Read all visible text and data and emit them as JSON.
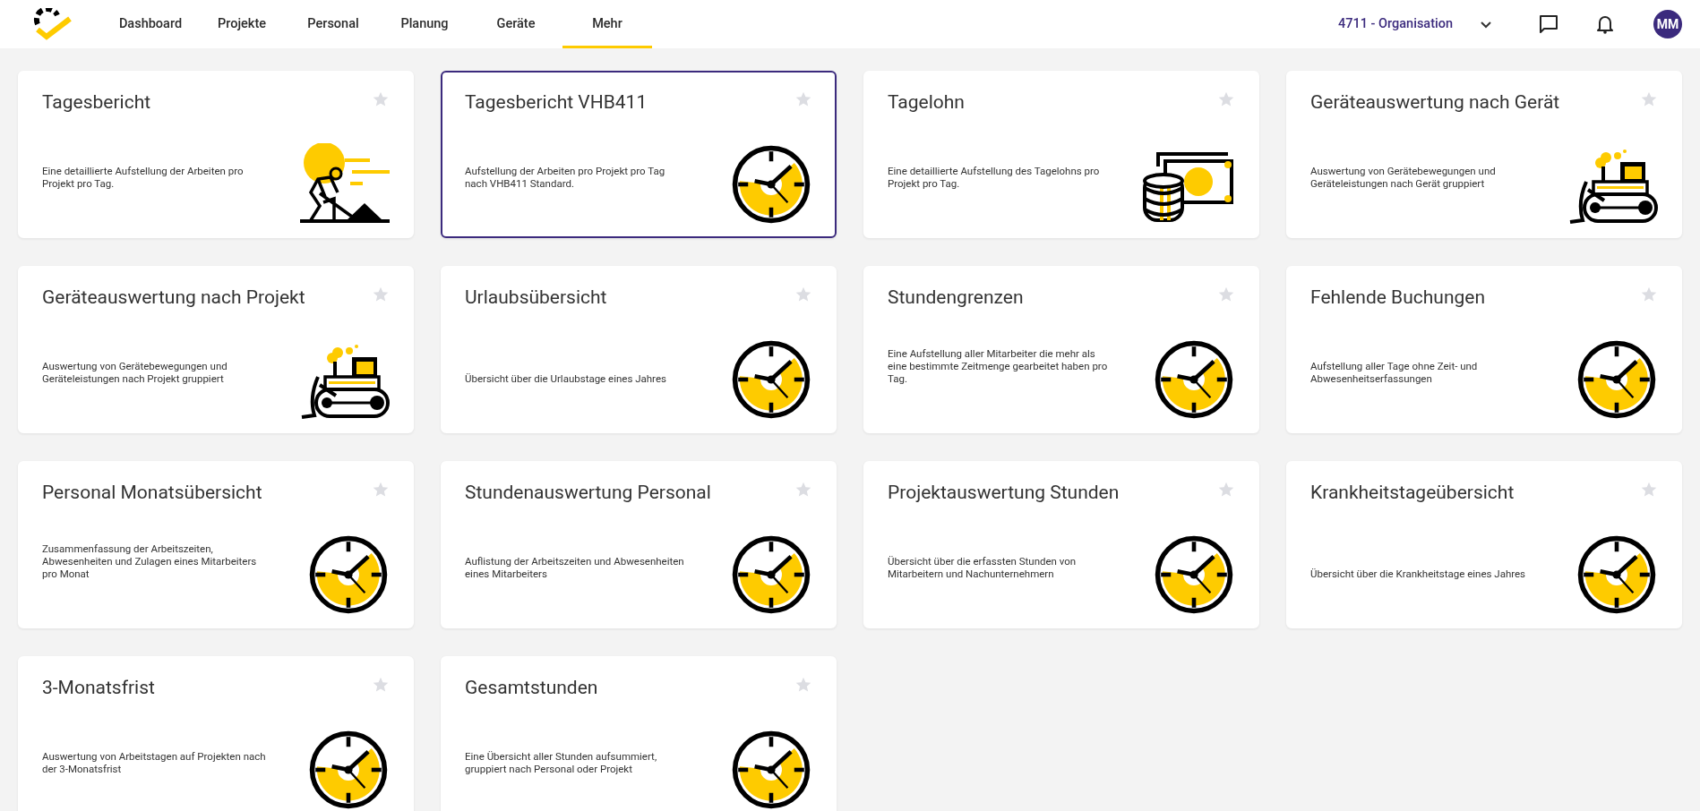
{
  "nav": {
    "items": [
      {
        "label": "Dashboard",
        "selected": false
      },
      {
        "label": "Projekte",
        "selected": false
      },
      {
        "label": "Personal",
        "selected": false
      },
      {
        "label": "Planung",
        "selected": false
      },
      {
        "label": "Geräte",
        "selected": false
      },
      {
        "label": "Mehr",
        "selected": true
      }
    ],
    "organisation": "4711 - Organisation",
    "avatar": "MM"
  },
  "cards": [
    {
      "title": "Tagesbericht",
      "description": "Eine detaillierte Aufstellung der Arbeiten pro Projekt pro Tag.",
      "kind": "worker",
      "selected": false,
      "favorite": false
    },
    {
      "title": "Tagesbericht VHB411",
      "description": "Aufstellung der Arbeiten pro Projekt pro Tag nach VHB411 Standard.",
      "kind": "clock",
      "selected": true,
      "favorite": false
    },
    {
      "title": "Tagelohn",
      "description": "Eine detaillierte Aufstellung des Tagelohns pro Projekt pro Tag.",
      "kind": "money",
      "selected": false,
      "favorite": false
    },
    {
      "title": "Geräteauswertung nach Gerät",
      "description": "Auswertung von Gerätebewegungen und Geräteleistungen nach Gerät gruppiert",
      "kind": "bulldozer",
      "selected": false,
      "favorite": false
    },
    {
      "title": "Geräteauswertung nach Projekt",
      "description": "Auswertung von Gerätebewegungen und Geräteleistungen nach Projekt gruppiert",
      "kind": "bulldozer",
      "selected": false,
      "favorite": false
    },
    {
      "title": "Urlaubsübersicht",
      "description": "Übersicht über die Urlaubstage eines Jahres",
      "kind": "clock",
      "selected": false,
      "favorite": false
    },
    {
      "title": "Stundengrenzen",
      "description": "Eine Aufstellung aller Mitarbeiter die mehr als eine bestimmte Zeitmenge gearbeitet haben pro Tag.",
      "kind": "clock",
      "selected": false,
      "favorite": false
    },
    {
      "title": "Fehlende Buchungen",
      "description": "Aufstellung aller Tage ohne Zeit- und Abwesenheitserfassungen",
      "kind": "clock",
      "selected": false,
      "favorite": false
    },
    {
      "title": "Personal Monatsübersicht",
      "description": "Zusammenfassung der Arbeitszeiten, Abwesenheiten und Zulagen eines Mitarbeiters pro Monat",
      "kind": "clock",
      "selected": false,
      "favorite": false
    },
    {
      "title": "Stundenauswertung Personal",
      "description": "Auflistung der Arbeitszeiten und Abwesenheiten eines Mitarbeiters",
      "kind": "clock",
      "selected": false,
      "favorite": false
    },
    {
      "title": "Projektauswertung Stunden",
      "description": "Übersicht über die erfassten Stunden von Mitarbeitern und Nachunternehmern",
      "kind": "clock",
      "selected": false,
      "favorite": false
    },
    {
      "title": "Krankheitstageübersicht",
      "description": "Übersicht über die Krankheitstage eines Jahres",
      "kind": "clock",
      "selected": false,
      "favorite": false
    },
    {
      "title": "3-Monatsfrist",
      "description": "Auswertung von Arbeitstagen auf Projekten nach der 3-Monatsfrist",
      "kind": "clock",
      "selected": false,
      "favorite": false
    },
    {
      "title": "Gesamtstunden",
      "description": "Eine Übersicht aller Stunden aufsummiert, gruppiert nach Personal oder Projekt",
      "kind": "clock",
      "selected": false,
      "favorite": false
    }
  ]
}
